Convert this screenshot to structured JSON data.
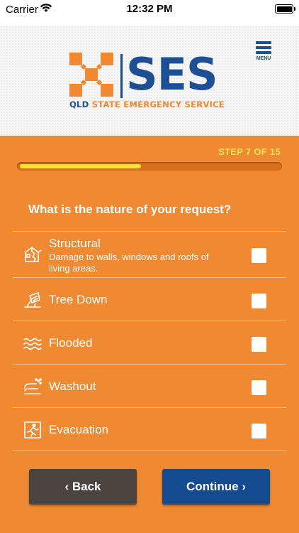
{
  "status_bar": {
    "carrier": "Carrier",
    "time": "12:32 PM"
  },
  "header": {
    "logo_word": "SES",
    "tagline_part1": "QLD ",
    "tagline_part2": "STATE EMERGENCY SERVICE",
    "menu_label": "MENU"
  },
  "progress": {
    "step_text": "STEP 7 OF 15",
    "fraction": 0.466
  },
  "question": "What is the nature of your request?",
  "options": [
    {
      "label": "Structural",
      "description": "Damage to walls, windows and roofs of living areas.",
      "icon": "house-damage-icon",
      "checked": false
    },
    {
      "label": "Tree Down",
      "description": "",
      "icon": "tree-down-icon",
      "checked": false
    },
    {
      "label": "Flooded",
      "description": "",
      "icon": "water-waves-icon",
      "checked": false
    },
    {
      "label": "Washout",
      "description": "",
      "icon": "washout-icon",
      "checked": false
    },
    {
      "label": "Evacuation",
      "description": "",
      "icon": "evacuation-icon",
      "checked": false
    }
  ],
  "buttons": {
    "back": "‹ Back",
    "continue": "Continue ›"
  },
  "colors": {
    "background": "#F08A32",
    "brand_blue": "#1C4F94",
    "step_yellow": "#FFE25A",
    "back_button": "#4A433E",
    "continue_button": "#144A8F"
  }
}
